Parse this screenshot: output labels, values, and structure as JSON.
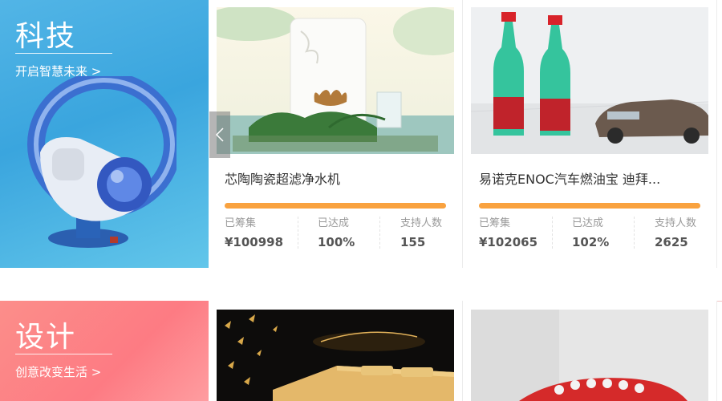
{
  "sections": [
    {
      "banner": {
        "title": "科技",
        "subtitle": "开启智慧未来 >"
      },
      "cards": [
        {
          "title": "芯陶陶瓷超滤净水机",
          "progress_percent": 100,
          "raised_label": "已筹集",
          "raised_value": "¥100998",
          "achieved_label": "已达成",
          "achieved_value": "100%",
          "backers_label": "支持人数",
          "backers_value": "155"
        },
        {
          "title": "易诺克ENOC汽车燃油宝 迪拜...",
          "progress_percent": 100,
          "raised_label": "已筹集",
          "raised_value": "¥102065",
          "achieved_label": "已达成",
          "achieved_value": "102%",
          "backers_label": "支持人数",
          "backers_value": "2625"
        }
      ]
    },
    {
      "banner": {
        "title": "设计",
        "subtitle": "创意改变生活 >"
      }
    }
  ],
  "carousel": {
    "prev_icon": "chevron-left-icon"
  },
  "colors": {
    "tech_banner": "#3aa5de",
    "design_banner": "#fd7b83",
    "progress": "#f9a23f"
  }
}
